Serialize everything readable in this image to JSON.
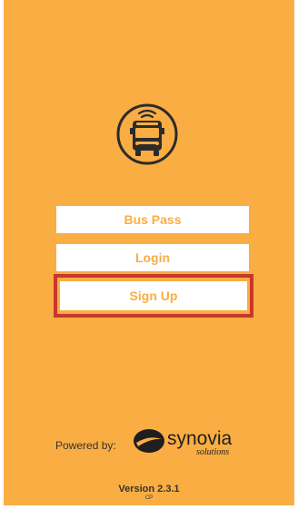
{
  "app": {
    "buttons": {
      "bus_pass": "Bus Pass",
      "login": "Login",
      "sign_up": "Sign Up"
    },
    "footer": {
      "powered_by": "Powered by:",
      "brand_name": "synovia",
      "brand_sub": "solutions",
      "version": "Version 2.3.1",
      "build": "CP"
    }
  },
  "colors": {
    "background": "#f9ad43",
    "button_bg": "#ffffff",
    "button_text": "#f9ad43",
    "highlight": "#c8372a"
  },
  "icons": {
    "app_logo": "bus-signal-icon",
    "brand_logo": "synovia-logo"
  }
}
